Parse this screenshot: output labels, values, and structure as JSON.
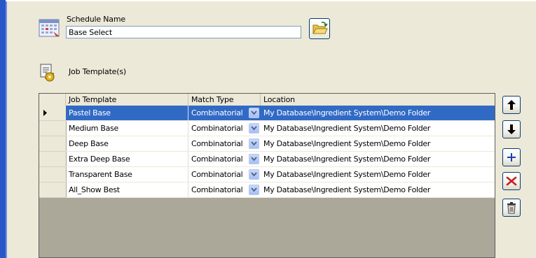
{
  "schedule": {
    "label": "Schedule Name",
    "value": "Base Select"
  },
  "job_templates": {
    "label": "Job Template(s)",
    "columns": [
      "Job Template",
      "Match Type",
      "Location"
    ],
    "rows": [
      {
        "name": "Pastel Base",
        "match": "Combinatorial",
        "location": "My Database\\Ingredient System\\Demo Folder",
        "selected": true
      },
      {
        "name": "Medium Base",
        "match": "Combinatorial",
        "location": "My Database\\Ingredient System\\Demo Folder",
        "selected": false
      },
      {
        "name": "Deep Base",
        "match": "Combinatorial",
        "location": "My Database\\Ingredient System\\Demo Folder",
        "selected": false
      },
      {
        "name": "Extra Deep Base",
        "match": "Combinatorial",
        "location": "My Database\\Ingredient System\\Demo Folder",
        "selected": false
      },
      {
        "name": "Transparent Base",
        "match": "Combinatorial",
        "location": "My Database\\Ingredient System\\Demo Folder",
        "selected": false
      },
      {
        "name": "All_Show Best",
        "match": "Combinatorial",
        "location": "My Database\\Ingredient System\\Demo Folder",
        "selected": false
      }
    ]
  },
  "side_buttons": [
    "move-up-icon",
    "move-down-icon",
    "add-icon",
    "remove-icon",
    "delete-icon"
  ],
  "icons": {
    "schedule": "calendar-icon",
    "job_template": "document-gear-icon",
    "browse": "open-folder-icon"
  },
  "colors": {
    "selection": "#316ac5",
    "background": "#ece9d8",
    "grid_empty": "#aca899",
    "window_border": "#2a57c7"
  }
}
